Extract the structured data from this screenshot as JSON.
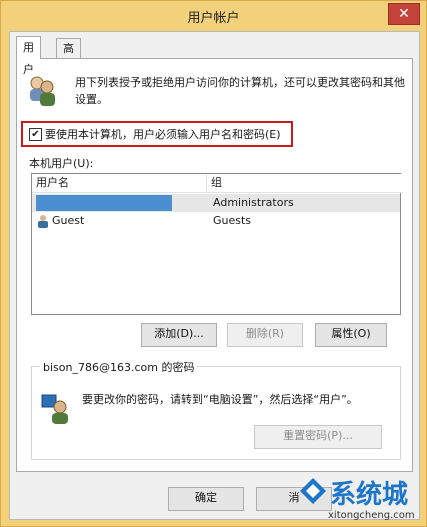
{
  "window": {
    "title": "用户帐户",
    "close_glyph": "✕"
  },
  "tabs": [
    {
      "label": "用户",
      "active": true
    },
    {
      "label": "高级",
      "active": false
    }
  ],
  "intro_text": "用下列表授予或拒绝用户访问你的计算机，还可以更改其密码和其他设置。",
  "require_login": {
    "checked": true,
    "label": "要使用本计算机，用户必须输入用户名和密码(E)"
  },
  "local_users_label": "本机用户(U):",
  "users_table": {
    "columns": [
      "用户名",
      "组"
    ],
    "rows": [
      {
        "name": "",
        "group": "Administrators",
        "selected": true
      },
      {
        "name": "Guest",
        "group": "Guests",
        "selected": false
      }
    ]
  },
  "buttons": {
    "add": "添加(D)...",
    "remove": "删除(R)",
    "properties": "属性(O)",
    "reset_password": "重置密码(P)...",
    "ok": "确定",
    "cancel": "消"
  },
  "password_group": {
    "title": "bison_786@163.com 的密码",
    "text": "要更改你的密码，请转到“电脑设置”，然后选择“用户”。"
  },
  "watermark": {
    "text": "系统城",
    "url": "xitongcheng.com"
  },
  "colors": {
    "titlebar": "#f3d07a",
    "close": "#c4443b",
    "highlight_border": "#c81c1c",
    "selection": "#4a8fd1"
  }
}
